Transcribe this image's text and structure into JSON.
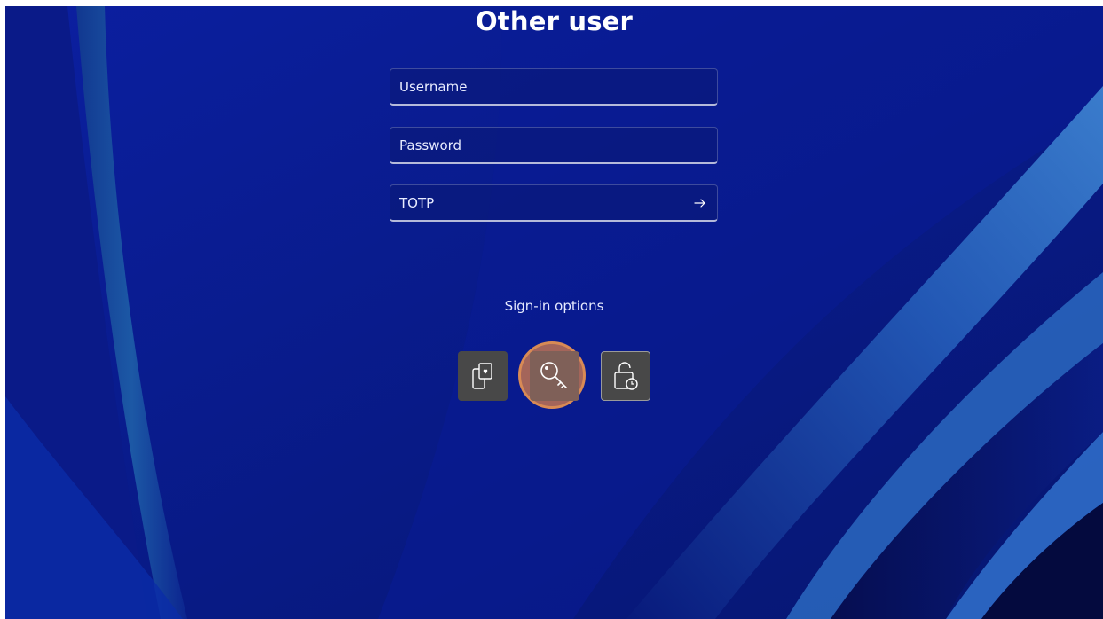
{
  "screen": {
    "title": "Other user"
  },
  "fields": {
    "username_placeholder": "Username",
    "password_placeholder": "Password",
    "totp_placeholder": "TOTP"
  },
  "signin_options": {
    "label": "Sign-in options",
    "options": [
      {
        "icon": "phone-icon",
        "selected": false
      },
      {
        "icon": "key-icon",
        "selected": true
      },
      {
        "icon": "lock-clock-icon",
        "selected": false
      }
    ]
  },
  "colors": {
    "background": "#0a1a8c",
    "selected_highlight": "#e08246",
    "option_tile": "#484848"
  },
  "icons": {
    "submit": "arrow-right-icon"
  }
}
